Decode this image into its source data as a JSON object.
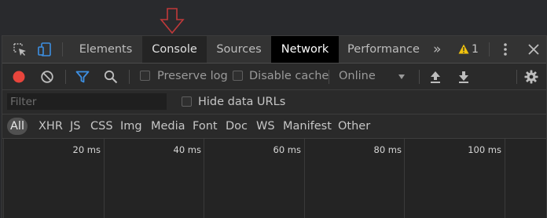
{
  "tabs": {
    "elements": "Elements",
    "console": "Console",
    "sources": "Sources",
    "network": "Network",
    "performance": "Performance",
    "more": "»"
  },
  "warnings": {
    "count": "1"
  },
  "toolbar": {
    "preserve_log": "Preserve log",
    "disable_cache": "Disable cache",
    "throttling": "Online"
  },
  "filter": {
    "placeholder": "Filter",
    "hide_data_urls": "Hide data URLs"
  },
  "types": [
    "All",
    "XHR",
    "JS",
    "CSS",
    "Img",
    "Media",
    "Font",
    "Doc",
    "WS",
    "Manifest",
    "Other"
  ],
  "timeline": {
    "ticks": [
      "20 ms",
      "40 ms",
      "60 ms",
      "80 ms",
      "100 ms"
    ]
  },
  "colors": {
    "record": "#e8453c",
    "filter_icon": "#3d8fe2",
    "device_icon": "#3d8fe2",
    "warning": "#f0c20d",
    "pointer_arrow": "#c0393a"
  },
  "icons": [
    "inspect-element-icon",
    "device-toolbar-icon",
    "record-icon",
    "clear-icon",
    "filter-icon",
    "search-icon",
    "import-har-icon",
    "export-har-icon",
    "settings-gear-icon",
    "more-options-icon",
    "close-icon",
    "warning-icon",
    "down-arrow-pointer-icon"
  ]
}
